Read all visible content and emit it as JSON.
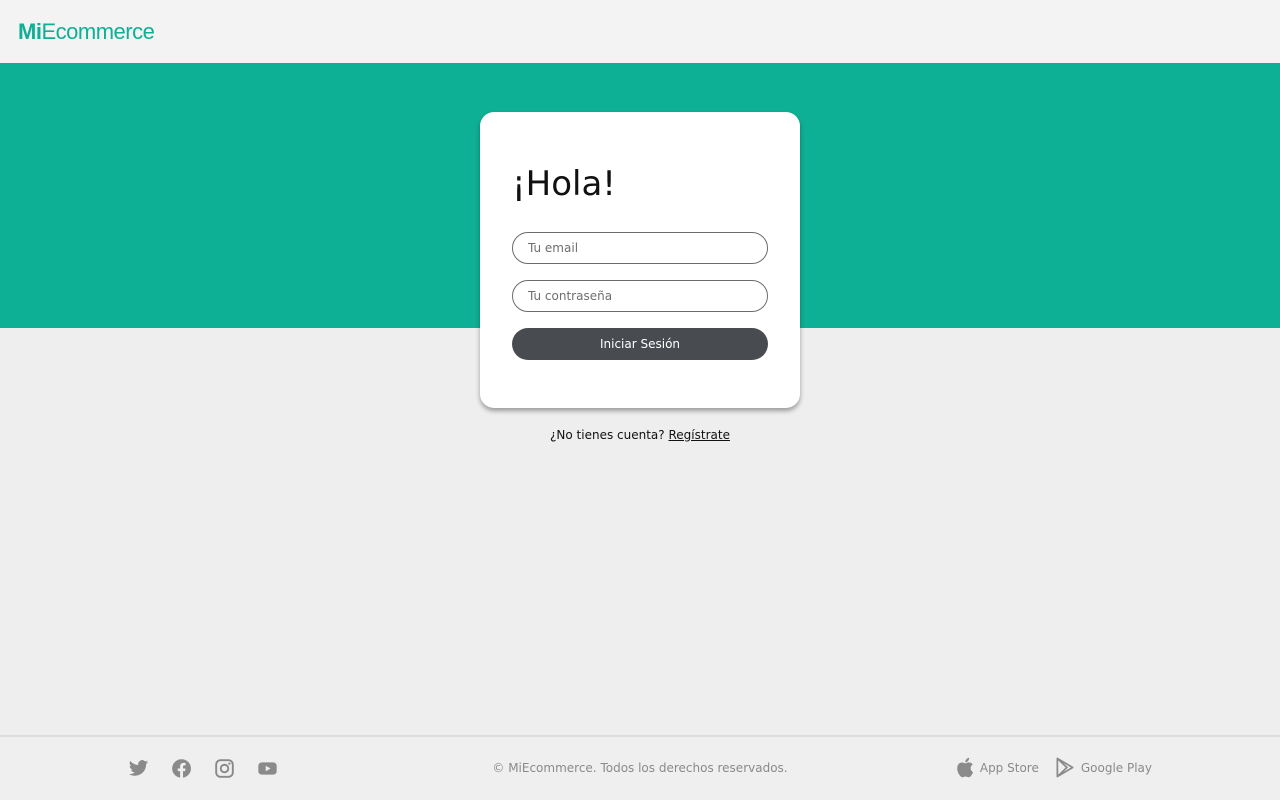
{
  "header": {
    "logo_bold": "Mi",
    "logo_light": "Ecommerce"
  },
  "login": {
    "title": "¡Hola!",
    "email_placeholder": "Tu email",
    "password_placeholder": "Tu contraseña",
    "submit_label": "Iniciar Sesión"
  },
  "register": {
    "prompt": "¿No tienes cuenta?",
    "link_label": "Regístrate"
  },
  "footer": {
    "social": [
      "twitter-icon",
      "facebook-icon",
      "instagram-icon",
      "youtube-icon"
    ],
    "copyright": "© MiEcommerce. Todos los derechos reservados.",
    "app_store_label": "App Store",
    "google_play_label": "Google Play"
  },
  "colors": {
    "brand": "#0eb095",
    "button": "#484c50",
    "background": "#eeeeee",
    "header": "#f3f3f3",
    "footer_text": "#8a8a8a"
  }
}
